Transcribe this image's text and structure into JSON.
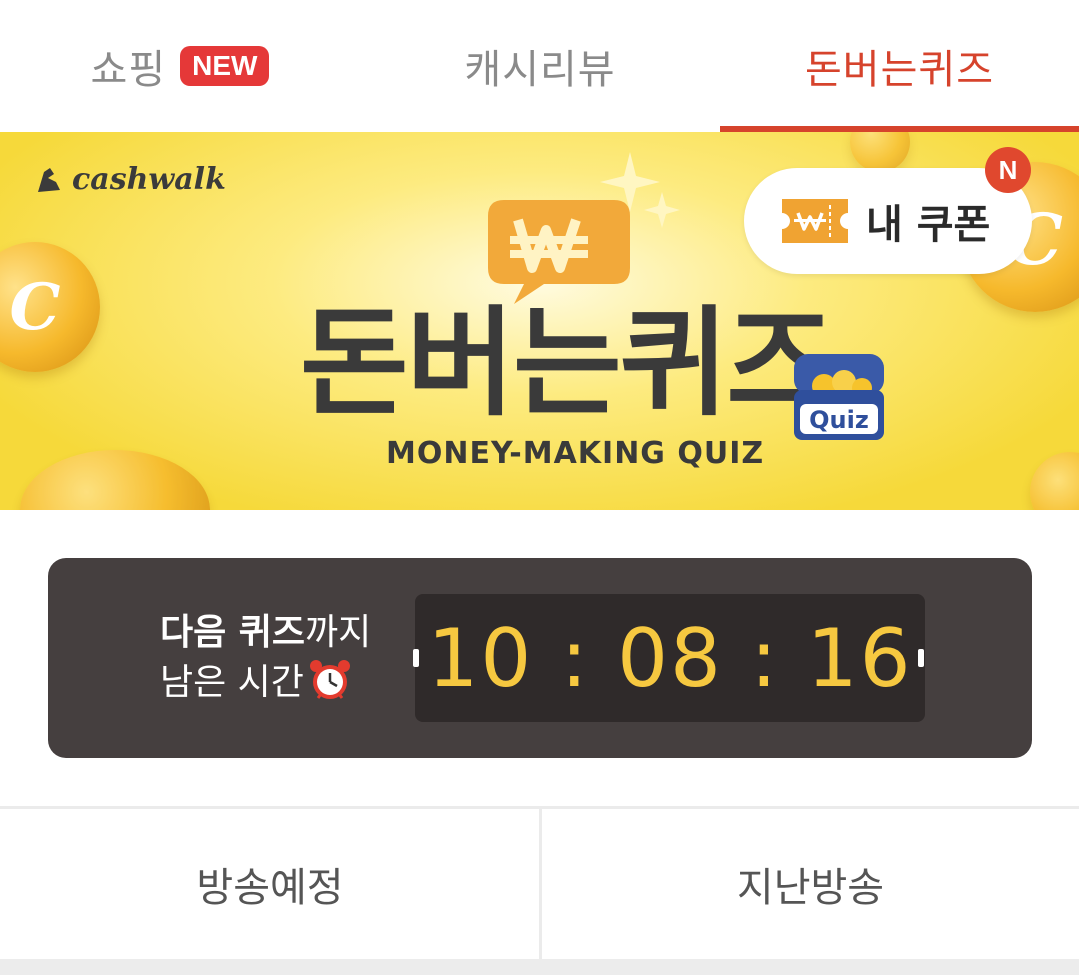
{
  "tabs": [
    {
      "label": "쇼핑",
      "badge": "NEW",
      "active": false
    },
    {
      "label": "캐시리뷰",
      "active": false
    },
    {
      "label": "돈버는퀴즈",
      "active": true
    }
  ],
  "banner": {
    "brand": "cashwalk",
    "title": "돈버는퀴즈",
    "subtitle": "MONEY-MAKING QUIZ",
    "chest_text": "Quiz",
    "coin_letter": "C",
    "coupon_label": "내 쿠폰",
    "coupon_badge": "N"
  },
  "timer": {
    "label_bold": "다음 퀴즈",
    "label_suffix": "까지",
    "label_line2": "남은 시간",
    "value": "10 : 08 : 16"
  },
  "sub_tabs": [
    {
      "label": "방송예정"
    },
    {
      "label": "지난방송"
    }
  ],
  "colors": {
    "accent": "#d6432c",
    "badge_red": "#e53838",
    "banner_yellow": "#f6d93a",
    "timer_bg": "#453f3f",
    "timer_digits": "#f6c840"
  }
}
